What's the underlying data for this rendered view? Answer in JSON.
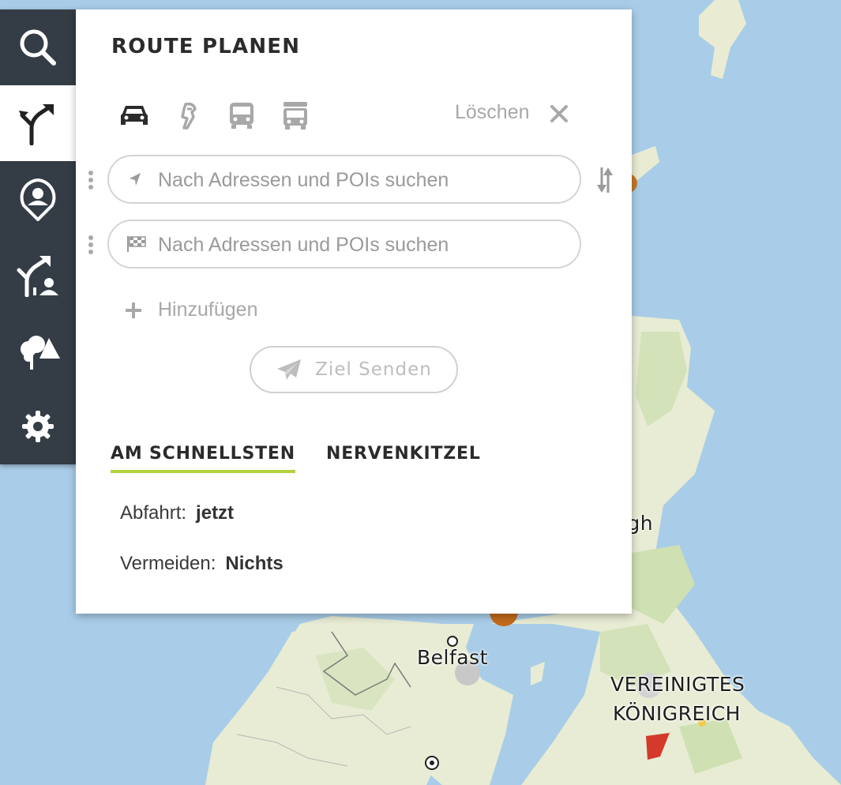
{
  "panel": {
    "title": "ROUTE PLANEN",
    "clear_label": "Löschen",
    "search_placeholder_start": "Nach Adressen und POIs suchen",
    "search_placeholder_end": "Nach Adressen und POIs suchen",
    "add_label": "Hinzufügen",
    "send_label": "Ziel Senden"
  },
  "transport_modes": [
    "car-icon",
    "motorcycle-icon",
    "bus-icon",
    "truck-icon"
  ],
  "sidebar": {
    "items": [
      "search-icon",
      "route-icon",
      "profile-pin-icon",
      "shared-route-icon",
      "nature-icon",
      "settings-icon"
    ],
    "active_index": 1
  },
  "tabs": [
    "AM SCHNELLSTEN",
    "NERVENKITZEL"
  ],
  "active_tab": 0,
  "options": {
    "departure_label": "Abfahrt:",
    "departure_value": "jetzt",
    "avoid_label": "Vermeiden:",
    "avoid_value": "Nichts"
  },
  "map": {
    "labels": {
      "edinburgh_partial": "rgh",
      "belfast": "Belfast",
      "uk_line1": "VEREINIGTES",
      "uk_line2": "KÖNIGREICH"
    }
  },
  "colors": {
    "sidebar_bg": "#343c45",
    "tab_underline": "#b3d23e",
    "water": "#a9cde8",
    "land": "#e8ecd4"
  }
}
